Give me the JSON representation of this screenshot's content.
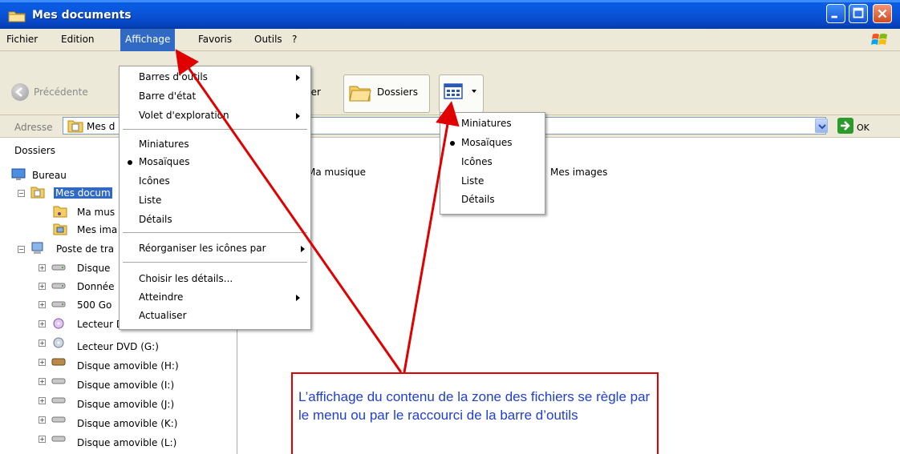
{
  "window": {
    "title": "Mes documents",
    "colors": {
      "titlebar": "#0a55d8",
      "menu_highlight": "#316ac5",
      "annotation": "#e00000",
      "callout_text": "#1f3fd1"
    }
  },
  "menubar": {
    "items": [
      "Fichier",
      "Edition",
      "Affichage",
      "Favoris",
      "Outils",
      "?"
    ],
    "active": "Affichage"
  },
  "toolbar": {
    "back_label": "Précédente",
    "search_partial": "her",
    "folders_label": "Dossiers"
  },
  "address": {
    "label": "Adresse",
    "value": "Mes d",
    "go_label": "OK"
  },
  "folder_pane": {
    "title": "Dossiers",
    "close": "×",
    "tree": [
      {
        "label": "Bureau",
        "icon": "desktop-icon"
      },
      {
        "label": "Mes docum",
        "icon": "my-documents-icon",
        "selected": true
      },
      {
        "label": "Ma mus",
        "icon": "music-folder-icon"
      },
      {
        "label": "Mes ima",
        "icon": "pictures-folder-icon"
      },
      {
        "label": "Poste de tra",
        "icon": "computer-icon"
      },
      {
        "label": "Disque",
        "icon": "drive-icon"
      },
      {
        "label": "Donnée",
        "icon": "drive-icon"
      },
      {
        "label": "500 Go",
        "icon": "drive-icon"
      },
      {
        "label": "Lecteur DVD-RAM (F:)",
        "icon": "dvd-icon"
      },
      {
        "label": "Lecteur DVD (G:)",
        "icon": "dvd-icon"
      },
      {
        "label": "Disque amovible (H:)",
        "icon": "removable-drive-icon"
      },
      {
        "label": "Disque amovible (I:)",
        "icon": "removable-drive-icon"
      },
      {
        "label": "Disque amovible (J:)",
        "icon": "removable-drive-icon"
      },
      {
        "label": "Disque amovible (K:)",
        "icon": "removable-drive-icon"
      },
      {
        "label": "Disque amovible (L:)",
        "icon": "removable-drive-icon"
      }
    ]
  },
  "content": {
    "items": [
      "Ma musique",
      "Mes images"
    ]
  },
  "affichage_menu": {
    "items": [
      {
        "label": "Barres d'outils",
        "submenu": true
      },
      {
        "label": "Barre d'état"
      },
      {
        "label": "Volet d'exploration",
        "submenu": true
      },
      {
        "label": "Miniatures"
      },
      {
        "label": "Mosaïques",
        "checked": true
      },
      {
        "label": "Icônes"
      },
      {
        "label": "Liste"
      },
      {
        "label": "Détails"
      },
      {
        "label": "Réorganiser les icônes par",
        "submenu": true
      },
      {
        "label": "Choisir les détails..."
      },
      {
        "label": "Atteindre",
        "submenu": true
      },
      {
        "label": "Actualiser"
      }
    ]
  },
  "views_menu": {
    "items": [
      {
        "label": "Miniatures"
      },
      {
        "label": "Mosaïques",
        "checked": true
      },
      {
        "label": "Icônes"
      },
      {
        "label": "Liste"
      },
      {
        "label": "Détails"
      }
    ]
  },
  "annotation": {
    "text": "L’affichage du contenu de la zone des fichiers se règle par le menu ou par le raccourci de la barre d’outils"
  }
}
